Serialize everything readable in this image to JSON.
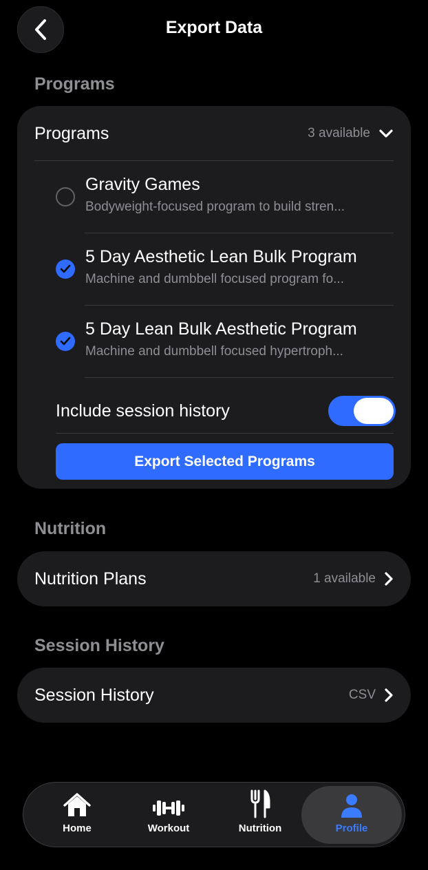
{
  "header": {
    "title": "Export Data"
  },
  "sections": {
    "programs_header": "Programs",
    "nutrition_header": "Nutrition",
    "session_header": "Session History"
  },
  "programs_card": {
    "title": "Programs",
    "count": "3 available",
    "items": [
      {
        "name": "Gravity Games",
        "description": "Bodyweight-focused program to build stren...",
        "selected": false
      },
      {
        "name": "5 Day Aesthetic Lean Bulk Program",
        "description": "Machine and dumbbell focused program fo...",
        "selected": true
      },
      {
        "name": "5 Day Lean Bulk Aesthetic Program",
        "description": "Machine and dumbbell focused hypertroph...",
        "selected": true
      }
    ],
    "toggle_label": "Include session history",
    "toggle_on": true,
    "export_label": "Export Selected Programs"
  },
  "nutrition_card": {
    "title": "Nutrition Plans",
    "count": "1 available"
  },
  "session_card": {
    "title": "Session History",
    "format": "CSV"
  },
  "tabbar": {
    "tabs": [
      {
        "label": "Home",
        "icon": "house-icon"
      },
      {
        "label": "Workout",
        "icon": "dumbbell-icon"
      },
      {
        "label": "Nutrition",
        "icon": "fork-knife-icon"
      },
      {
        "label": "Profile",
        "icon": "person-icon"
      }
    ],
    "active": "Profile"
  },
  "colors": {
    "accent": "#2f6bff",
    "card": "#1c1c1e",
    "muted": "#8e8e93",
    "background": "#000000"
  }
}
